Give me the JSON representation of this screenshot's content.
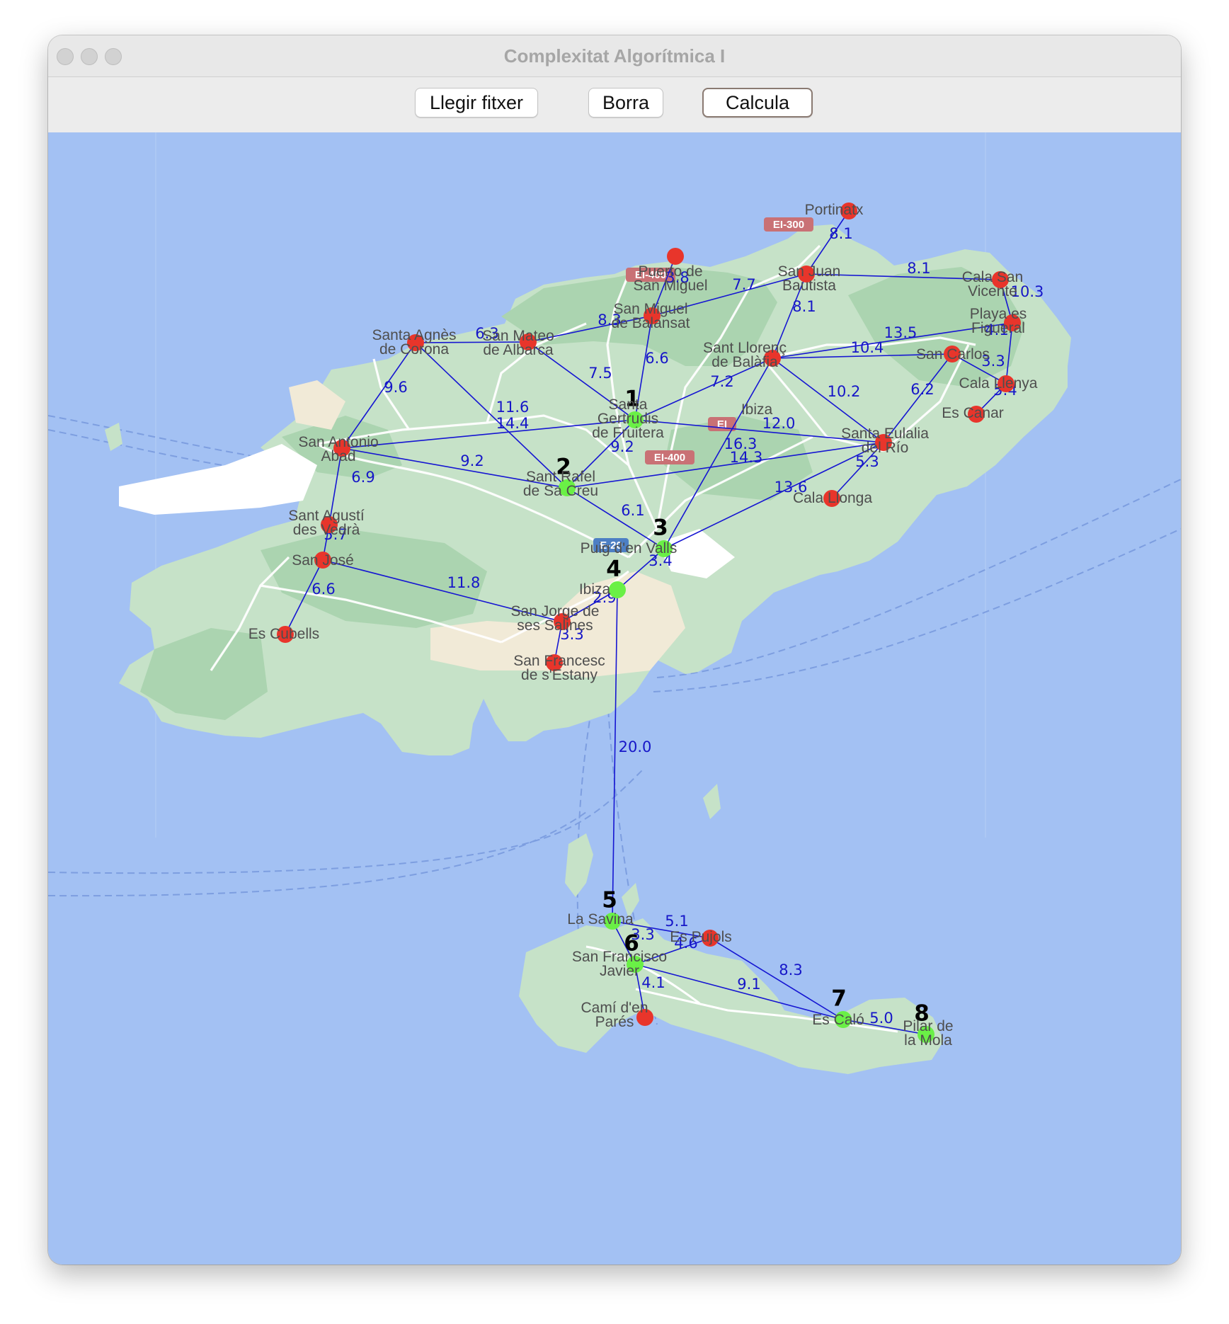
{
  "window": {
    "title": "Complexitat Algorítmica I"
  },
  "toolbar": {
    "buttons": [
      {
        "id": "open",
        "label": "Llegir fitxer"
      },
      {
        "id": "clear",
        "label": "Borra"
      },
      {
        "id": "compute",
        "label": "Calcula"
      }
    ]
  },
  "map": {
    "colors": {
      "sea": "#a3c1f3",
      "land": "#c6e2c8",
      "land_dark": "#abd4b0",
      "urban": "#f1ead7",
      "edge": "#1515d2",
      "edge_label": "#1616c8",
      "node_route": "#6af046",
      "node_other": "#e8352b",
      "place_label": "#4e4e4e"
    },
    "road_labels": [
      "EI-300",
      "EI-400",
      "EI-400",
      "EI",
      "E-20"
    ],
    "place_labels": [
      "Portinatx",
      "Puerto de\nSan Miguel",
      "San Juan\nBautista",
      "Cala San\nVicente",
      "San Miguel\nde Balansat",
      "Playa es\nFigueral",
      "Santa Agnès\nde Corona",
      "San Mateo\nde Albarca",
      "Sant Llorenç\nde Balàfia",
      "Ibiza",
      "San Carlos",
      "Cala Llenya",
      "Es Canar",
      "Santa\nGertrudis\nde Fruitera",
      "San Antonio\nAbad",
      "Santa Eulalia\ndel Río",
      "Sant Rafel\nde Sa Creu",
      "Cala Llonga",
      "Sant Agustí\ndes Vedrà",
      "Puig d'en Valls",
      "San José",
      "Ibiza",
      "San Jorge de\nses Salines",
      "Es Cubells",
      "San Francesc\nde s'Estany",
      "La Savina",
      "Es Pujols",
      "San Francisco\nJavier",
      "Camí d'en\nParés",
      "Es Caló",
      "Pilar de\nla Mola"
    ],
    "route_order": [
      "1",
      "2",
      "3",
      "4",
      "5",
      "6",
      "7",
      "8"
    ],
    "edge_labels": [
      "8.1",
      "8.1",
      "10.3",
      "3.8",
      "7.7",
      "8.1",
      "8.3",
      "6.3",
      "4.1",
      "13.5",
      "10.4",
      "3.3",
      "6.6",
      "7.5",
      "7.2",
      "10.2",
      "6.2",
      "5.4",
      "9.6",
      "11.6",
      "14.4",
      "12.0",
      "9.2",
      "9.2",
      "16.3",
      "14.3",
      "5.3",
      "6.9",
      "13.6",
      "6.1",
      "5.7",
      "3.4",
      "11.8",
      "6.6",
      "2.9",
      "3.3",
      "20.0",
      "5.1",
      "3.3",
      "4.6",
      "8.3",
      "4.1",
      "9.1",
      "5.0"
    ]
  }
}
